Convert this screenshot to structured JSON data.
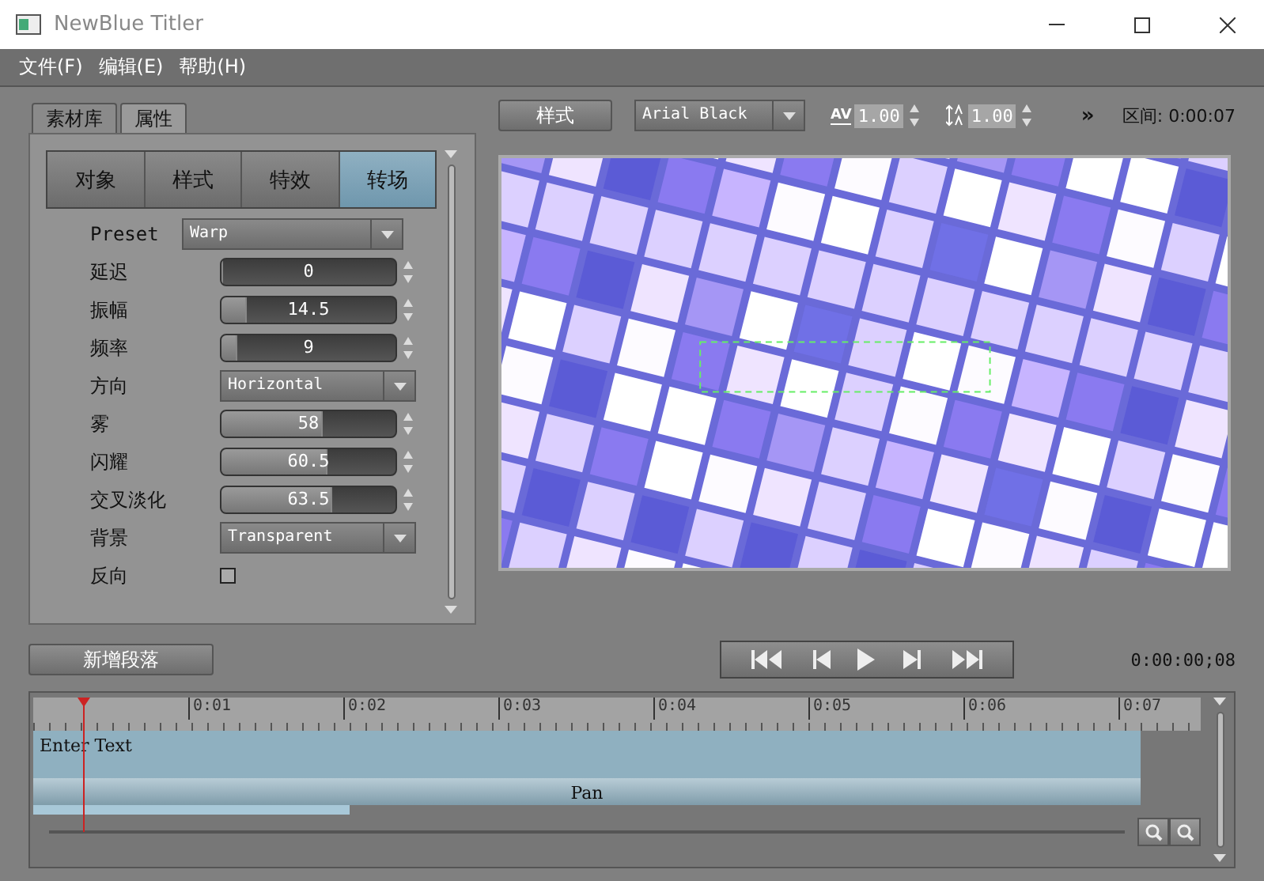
{
  "window": {
    "title": "NewBlue Titler"
  },
  "menu": [
    "文件(F)",
    "编辑(E)",
    "帮助(H)"
  ],
  "panel_tabs": [
    {
      "label": "素材库",
      "selected": false
    },
    {
      "label": "属性",
      "selected": true
    }
  ],
  "sub_tabs": [
    {
      "label": "对象",
      "selected": false
    },
    {
      "label": "样式",
      "selected": false
    },
    {
      "label": "特效",
      "selected": false
    },
    {
      "label": "转场",
      "selected": true
    }
  ],
  "properties": [
    {
      "kind": "dropdown",
      "label": "Preset",
      "value": "Warp"
    },
    {
      "kind": "slider",
      "label": "延迟",
      "value": "0",
      "level": 0
    },
    {
      "kind": "slider",
      "label": "振幅",
      "value": "14.5",
      "level": 0.145
    },
    {
      "kind": "slider",
      "label": "频率",
      "value": "9",
      "level": 0.09
    },
    {
      "kind": "dropdown",
      "label": "方向",
      "value": "Horizontal"
    },
    {
      "kind": "slider",
      "label": "雾",
      "value": "58",
      "level": 0.58
    },
    {
      "kind": "slider",
      "label": "闪耀",
      "value": "60.5",
      "level": 0.605
    },
    {
      "kind": "slider",
      "label": "交叉淡化",
      "value": "63.5",
      "level": 0.635
    },
    {
      "kind": "dropdown",
      "label": "背景",
      "value": "Transparent"
    },
    {
      "kind": "checkbox",
      "label": "反向",
      "checked": false
    }
  ],
  "toolbar": {
    "style_button": "样式",
    "font": "Arial Black",
    "tracking_label": "AV",
    "tracking": "1.00",
    "leading": "1.00",
    "more": "»",
    "duration": "区间: 0:00:07"
  },
  "add_paragraph_button": "新增段落",
  "current_time": "0:00:00;08",
  "timeline": {
    "ruler": [
      "0:01",
      "0:02",
      "0:03",
      "0:04",
      "0:05",
      "0:06",
      "0:07"
    ],
    "tracks": [
      {
        "kind": "text",
        "label": "Enter Text"
      },
      {
        "kind": "transition",
        "label": "Pan"
      },
      {
        "kind": "partial"
      }
    ]
  }
}
